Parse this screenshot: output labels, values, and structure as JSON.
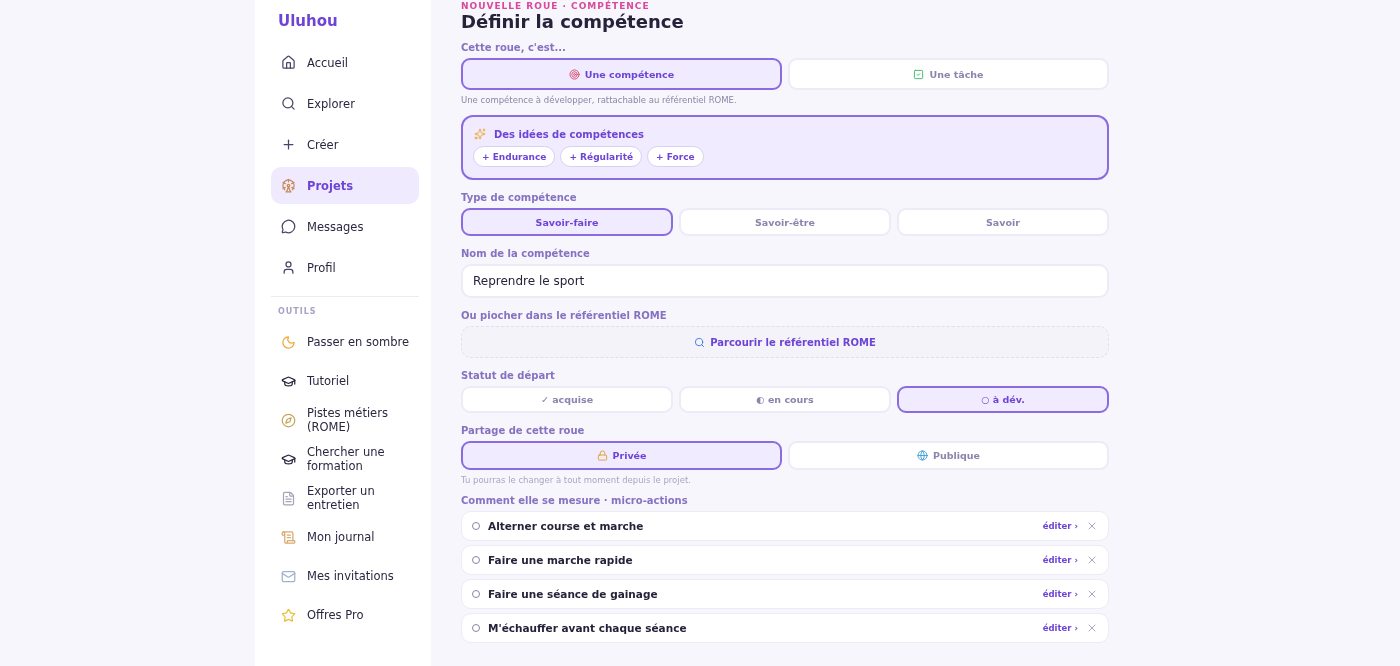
{
  "sidebar": {
    "brand": "Uluhou",
    "items": [
      {
        "label": "Accueil",
        "selected": false
      },
      {
        "label": "Explorer",
        "selected": false
      },
      {
        "label": "Créer",
        "selected": false
      },
      {
        "label": "Projets",
        "selected": true
      },
      {
        "label": "Messages",
        "selected": false
      },
      {
        "label": "Profil",
        "selected": false
      }
    ],
    "tools_heading": "OUTILS",
    "tools": [
      {
        "label": "Passer en sombre"
      },
      {
        "label": "Tutoriel"
      },
      {
        "label": "Pistes métiers (ROME)"
      },
      {
        "label": "Chercher une formation"
      },
      {
        "label": "Exporter un entretien"
      },
      {
        "label": "Mon journal"
      },
      {
        "label": "Mes invitations"
      },
      {
        "label": "Offres Pro"
      }
    ]
  },
  "main": {
    "eyebrow": "NOUVELLE ROUE · COMPÉTENCE",
    "title": "Définir la compétence",
    "kind_label": "Cette roue, c'est...",
    "kind_options": [
      {
        "label": "Une compétence",
        "selected": true
      },
      {
        "label": "Une tâche",
        "selected": false
      }
    ],
    "kind_hint": "Une compétence à développer, rattachable au référentiel ROME.",
    "ideas": {
      "title": "Des idées de compétences",
      "chips": [
        "+ Endurance",
        "+ Régularité",
        "+ Force"
      ]
    },
    "type_label": "Type de compétence",
    "type_options": [
      {
        "label": "Savoir-faire",
        "selected": true
      },
      {
        "label": "Savoir-être",
        "selected": false
      },
      {
        "label": "Savoir",
        "selected": false
      }
    ],
    "name_label": "Nom de la compétence",
    "name_value": "Reprendre le sport",
    "rome_label": "Ou piocher dans le référentiel ROME",
    "rome_button": "Parcourir le référentiel ROME",
    "status_label": "Statut de départ",
    "status_options": [
      {
        "label": "✓ acquise",
        "selected": false
      },
      {
        "label": "◐ en cours",
        "selected": false
      },
      {
        "label": "○ à dév.",
        "selected": true
      }
    ],
    "share_label": "Partage de cette roue",
    "share_options": [
      {
        "label": "Privée",
        "selected": true
      },
      {
        "label": "Publique",
        "selected": false
      }
    ],
    "share_hint": "Tu pourras le changer à tout moment depuis le projet.",
    "actions_label": "Comment elle se mesure · micro-actions",
    "actions": [
      {
        "label": "Alterner course et marche",
        "edit": "éditer ›"
      },
      {
        "label": "Faire une marche rapide",
        "edit": "éditer ›"
      },
      {
        "label": "Faire une séance de gainage",
        "edit": "éditer ›"
      },
      {
        "label": "M'échauffer avant chaque séance",
        "edit": "éditer ›"
      }
    ]
  }
}
